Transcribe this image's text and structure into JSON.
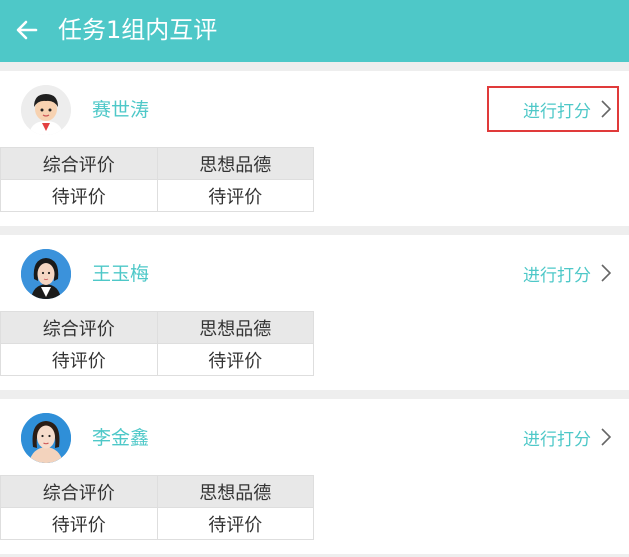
{
  "header": {
    "title": "任务1组内互评",
    "background": "#4ec8c8"
  },
  "evaluation_headers": [
    "综合评价",
    "思想品德"
  ],
  "students": [
    {
      "name": "赛世涛",
      "action_label": "进行打分",
      "statuses": [
        "待评价",
        "待评价"
      ],
      "avatar": "boy-cartoon-avatar",
      "highlighted": true
    },
    {
      "name": "王玉梅",
      "action_label": "进行打分",
      "statuses": [
        "待评价",
        "待评价"
      ],
      "avatar": "woman-photo-avatar",
      "highlighted": false
    },
    {
      "name": "李金鑫",
      "action_label": "进行打分",
      "statuses": [
        "待评价",
        "待评价"
      ],
      "avatar": "woman-photo-avatar",
      "highlighted": false
    }
  ],
  "colors": {
    "accent": "#4ec8c8",
    "highlight_border": "#e03a3a"
  }
}
